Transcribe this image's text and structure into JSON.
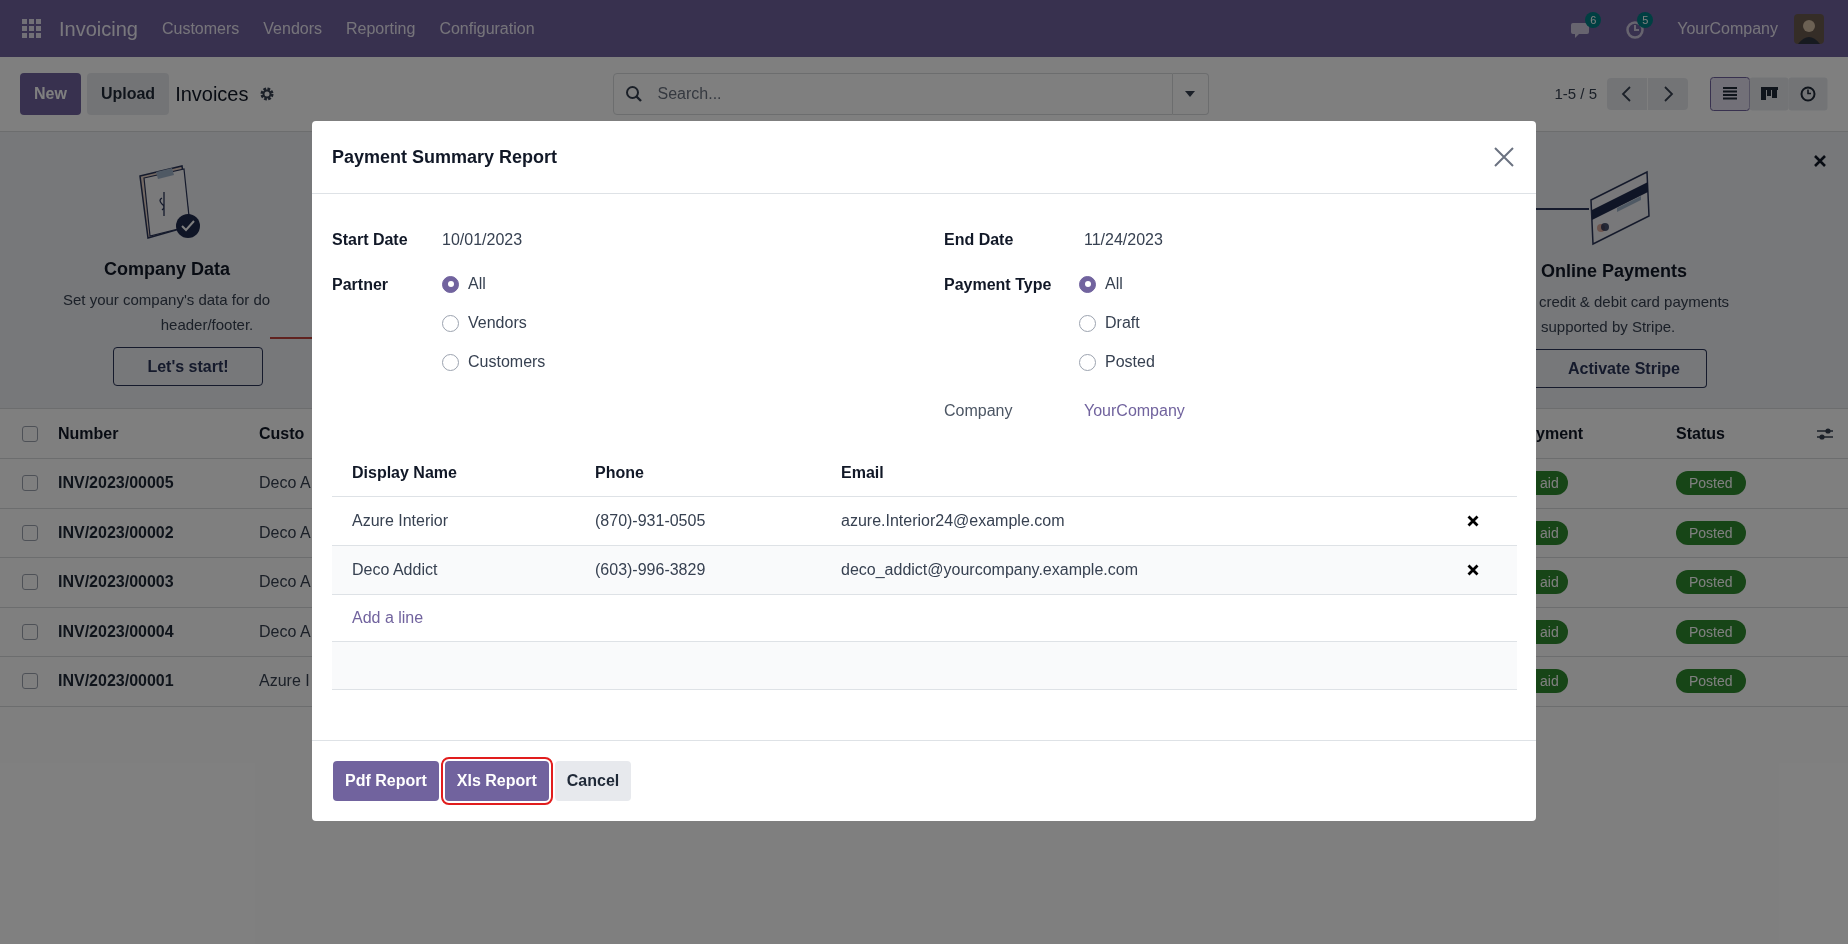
{
  "navbar": {
    "app": "Invoicing",
    "menu": [
      "Customers",
      "Vendors",
      "Reporting",
      "Configuration"
    ],
    "messages_count": "6",
    "activities_count": "5",
    "company": "YourCompany"
  },
  "control_panel": {
    "buttons": [
      {
        "label": "New",
        "kind": "primary"
      },
      {
        "label": "Upload",
        "kind": "secondary"
      }
    ],
    "title": "Invoices",
    "search": {
      "placeholder": "Search..."
    },
    "pager": "1-5 / 5",
    "views": [
      {
        "kind": "list",
        "selected": true
      },
      {
        "kind": "kanban",
        "selected": false
      },
      {
        "kind": "activity",
        "selected": false
      }
    ]
  },
  "banner": {
    "steps": [
      {
        "kind": "company",
        "title": "Company Data",
        "text_lines": [
          "Set your company's data for do",
          "header/footer."
        ],
        "button": "Let's start!"
      },
      {
        "kind": "payments",
        "title": "Online Payments",
        "text_lines": [
          "credit & debit card payments",
          "supported by Stripe."
        ],
        "button": "Activate Stripe"
      }
    ]
  },
  "list": {
    "select_all_checked": false,
    "columns": [
      "Number",
      "Custo",
      "yment",
      "Status"
    ],
    "rows": [
      {
        "checked": false,
        "number": "INV/2023/00005",
        "customer": "Deco A",
        "payment": "aid",
        "status": "Posted"
      },
      {
        "checked": false,
        "number": "INV/2023/00002",
        "customer": "Deco A",
        "payment": "aid",
        "status": "Posted"
      },
      {
        "checked": false,
        "number": "INV/2023/00003",
        "customer": "Deco A",
        "payment": "aid",
        "status": "Posted"
      },
      {
        "checked": false,
        "number": "INV/2023/00004",
        "customer": "Deco A",
        "payment": "aid",
        "status": "Posted"
      },
      {
        "checked": false,
        "number": "INV/2023/00001",
        "customer": "Azure I",
        "payment": "aid",
        "status": "Posted"
      }
    ]
  },
  "dialog": {
    "title": "Payment Summary Report",
    "start_date": {
      "label": "Start Date",
      "value": "10/01/2023"
    },
    "end_date": {
      "label": "End Date",
      "value": "11/24/2023"
    },
    "partner": {
      "label": "Partner",
      "options": [
        {
          "label": "All",
          "selected": true
        },
        {
          "label": "Vendors",
          "selected": false
        },
        {
          "label": "Customers",
          "selected": false
        }
      ]
    },
    "payment_type": {
      "label": "Payment Type",
      "options": [
        {
          "label": "All",
          "selected": true
        },
        {
          "label": "Draft",
          "selected": false
        },
        {
          "label": "Posted",
          "selected": false
        }
      ]
    },
    "company": {
      "label": "Company",
      "value": "YourCompany"
    },
    "partners": {
      "columns": [
        "Display Name",
        "Phone",
        "Email"
      ],
      "rows": [
        {
          "name": "Azure Interior",
          "phone": "(870)-931-0505",
          "email": "azure.Interior24@example.com"
        },
        {
          "name": "Deco Addict",
          "phone": "(603)-996-3829",
          "email": "deco_addict@yourcompany.example.com"
        }
      ],
      "add_line": "Add a line"
    },
    "buttons": [
      {
        "label": "Pdf Report",
        "kind": "primary",
        "highlighted": false
      },
      {
        "label": "Xls Report",
        "kind": "primary",
        "highlighted": true
      },
      {
        "label": "Cancel",
        "kind": "secondary",
        "highlighted": false
      }
    ]
  }
}
